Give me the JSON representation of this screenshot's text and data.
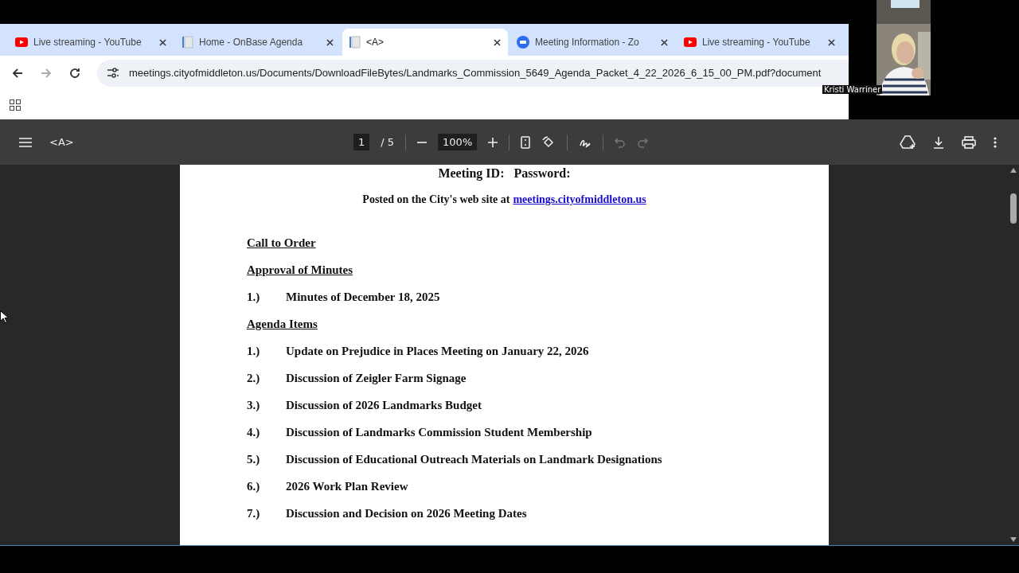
{
  "browser": {
    "tabs": [
      {
        "kind": "video",
        "title": "Live streaming - YouTube",
        "selected": false
      },
      {
        "kind": "document",
        "title": "Home - OnBase Agenda",
        "selected": false
      },
      {
        "kind": "document",
        "title": "<A>",
        "selected": true
      },
      {
        "kind": "meeting",
        "title": "Meeting Information - Zo",
        "selected": false
      },
      {
        "kind": "video",
        "title": "Live streaming - YouTube",
        "selected": false
      }
    ],
    "url": "meetings.cityofmiddleton.us/Documents/DownloadFileBytes/Landmarks_Commission_5649_Agenda_Packet_4_22_2026_6_15_00_PM.pdf?document"
  },
  "video_tile": {
    "kind": "picture",
    "name": "Kristi Warriner"
  },
  "pdf_viewer": {
    "title": "<A>",
    "page": "1",
    "page_total": "/ 5",
    "zoom": "100%"
  },
  "document": {
    "meeting_line": "Meeting ID:   Password:",
    "posted_text": "Posted on the City's web site at",
    "posted_link": "meetings.cityofmiddleton.us",
    "lines": [
      {
        "kind": "heading",
        "text": "Call to Order"
      },
      {
        "kind": "heading",
        "text": "Approval of Minutes"
      },
      {
        "kind": "item",
        "number": "1.)",
        "text": "Minutes of December 18, 2025"
      },
      {
        "kind": "heading",
        "text": "Agenda Items"
      },
      {
        "kind": "item",
        "number": "1.)",
        "text": "Update on Prejudice in Places Meeting on January 22, 2026"
      },
      {
        "kind": "item",
        "number": "2.)",
        "text": "Discussion of Zeigler Farm Signage"
      },
      {
        "kind": "item",
        "number": "3.)",
        "text": "Discussion of 2026 Landmarks Budget"
      },
      {
        "kind": "item",
        "number": "4.)",
        "text": "Discussion of Landmarks Commission Student Membership"
      },
      {
        "kind": "item",
        "number": "5.)",
        "text": "Discussion of Educational Outreach Materials on Landmark Designations"
      },
      {
        "kind": "item",
        "number": "6.)",
        "text": "2026 Work Plan Review"
      },
      {
        "kind": "item",
        "number": "7.)",
        "text": "Discussion and Decision on 2026 Meeting Dates"
      }
    ]
  }
}
